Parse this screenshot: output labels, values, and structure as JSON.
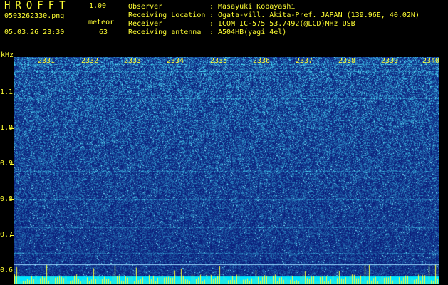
{
  "app": {
    "name": "HROFFT",
    "version": "1.00"
  },
  "file": {
    "name": "0503262330.png"
  },
  "meteor": {
    "label": "meteor",
    "count": "63"
  },
  "datetime": "05.03.26 23:30",
  "info": [
    {
      "key": "Observer",
      "value": "Masayuki Kobayashi"
    },
    {
      "key": "Receiving Location",
      "value": "Ogata-vill. Akita-Pref. JAPAN (139.96E, 40.02N)"
    },
    {
      "key": "Receiver",
      "value": "ICOM IC-575 53.7492(@LCD)MHz USB"
    },
    {
      "key": "Receiving antenna",
      "value": "A504HB(yagi 4el)"
    }
  ],
  "axis": {
    "unit": "kHz",
    "y_labels": [
      "1.1",
      "1.0",
      "0.9",
      "0.8",
      "0.7",
      "0.6"
    ],
    "x_labels": [
      "2331",
      "2332",
      "2333",
      "2334",
      "2335",
      "2336",
      "2337",
      "2338",
      "2339",
      "2340"
    ]
  },
  "colors": {
    "text": "#ffff33",
    "spectrogram_base": "#0b1f8a",
    "level_bar": "#00e5ff"
  }
}
